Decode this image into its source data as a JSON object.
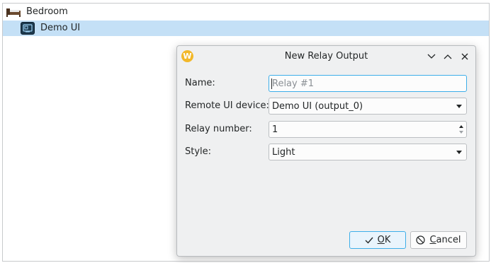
{
  "tree": {
    "items": [
      {
        "label": "Bedroom",
        "icon": "bed-icon"
      },
      {
        "label": "Demo UI",
        "icon": "remote-ui-icon",
        "selected": true
      }
    ]
  },
  "dialog": {
    "title": "New Relay Output",
    "app_icon": "W",
    "fields": {
      "name": {
        "label": "Name:",
        "placeholder": "Relay #1",
        "value": ""
      },
      "device": {
        "label": "Remote UI device:",
        "value": "Demo UI (output_0)"
      },
      "relay": {
        "label": "Relay number:",
        "value": "1"
      },
      "style": {
        "label": "Style:",
        "value": "Light"
      }
    },
    "buttons": {
      "ok": {
        "mnemonic": "O",
        "rest": "K"
      },
      "cancel": {
        "mnemonic": "C",
        "rest": "ancel"
      }
    }
  },
  "colors": {
    "selection": "#c4e0f6",
    "accent": "#3daee9",
    "app_icon": "#f2b82a"
  }
}
